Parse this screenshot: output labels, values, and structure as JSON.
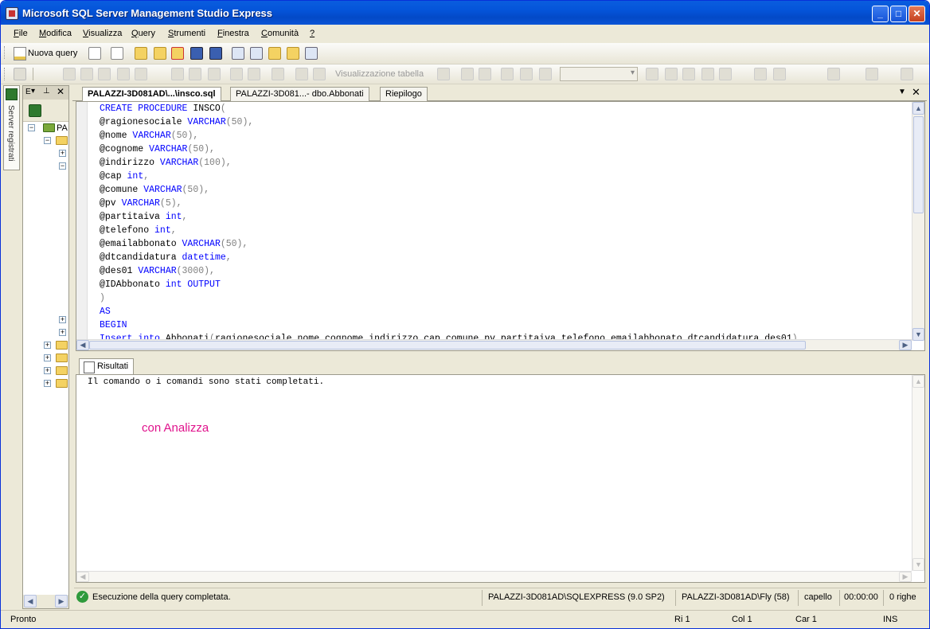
{
  "window": {
    "title": "Microsoft SQL Server Management Studio Express"
  },
  "menu": {
    "items": [
      "File",
      "Modifica",
      "Visualizza",
      "Query",
      "Strumenti",
      "Finestra",
      "Comunità",
      "?"
    ]
  },
  "toolbar": {
    "new_query": "Nuova query",
    "vis_tabella": "Visualizzazione tabella"
  },
  "sidebar": {
    "server_tab": "Server registrati",
    "oe_title": "E",
    "tree_root": "PA"
  },
  "doc_tabs": [
    {
      "label": "PALAZZI-3D081AD\\...\\insco.sql",
      "active": true
    },
    {
      "label": "PALAZZI-3D081...- dbo.Abbonati",
      "active": false
    },
    {
      "label": "Riepilogo",
      "active": false
    }
  ],
  "editor": {
    "lines": [
      [
        [
          "kw",
          "CREATE PROCEDURE"
        ],
        [
          "id",
          " INSCO"
        ],
        [
          "op",
          "("
        ]
      ],
      [
        [
          "id",
          "@ragionesociale "
        ],
        [
          "kw",
          "VARCHAR"
        ],
        [
          "op",
          "(50),"
        ]
      ],
      [
        [
          "id",
          "@nome "
        ],
        [
          "kw",
          "VARCHAR"
        ],
        [
          "op",
          "(50),"
        ]
      ],
      [
        [
          "id",
          "@cognome "
        ],
        [
          "kw",
          "VARCHAR"
        ],
        [
          "op",
          "(50),"
        ]
      ],
      [
        [
          "id",
          "@indirizzo "
        ],
        [
          "kw",
          "VARCHAR"
        ],
        [
          "op",
          "(100),"
        ]
      ],
      [
        [
          "id",
          "@cap "
        ],
        [
          "kw",
          "int"
        ],
        [
          "op",
          ","
        ]
      ],
      [
        [
          "id",
          "@comune "
        ],
        [
          "kw",
          "VARCHAR"
        ],
        [
          "op",
          "(50),"
        ]
      ],
      [
        [
          "id",
          "@pv "
        ],
        [
          "kw",
          "VARCHAR"
        ],
        [
          "op",
          "(5),"
        ]
      ],
      [
        [
          "id",
          "@partitaiva "
        ],
        [
          "kw",
          "int"
        ],
        [
          "op",
          ","
        ]
      ],
      [
        [
          "id",
          "@telefono "
        ],
        [
          "kw",
          "int"
        ],
        [
          "op",
          ","
        ]
      ],
      [
        [
          "id",
          "@emailabbonato "
        ],
        [
          "kw",
          "VARCHAR"
        ],
        [
          "op",
          "(50),"
        ]
      ],
      [
        [
          "id",
          "@dtcandidatura "
        ],
        [
          "kw",
          "datetime"
        ],
        [
          "op",
          ","
        ]
      ],
      [
        [
          "id",
          "@des01 "
        ],
        [
          "kw",
          "VARCHAR"
        ],
        [
          "op",
          "(3000),"
        ]
      ],
      [
        [
          "id",
          "@IDAbbonato "
        ],
        [
          "kw",
          "int OUTPUT"
        ]
      ],
      [
        [
          "op",
          ")"
        ]
      ],
      [
        [
          "kw",
          "AS"
        ]
      ],
      [
        [
          "kw",
          "BEGIN"
        ]
      ],
      [
        [
          "kw",
          "Insert into"
        ],
        [
          "id",
          " Abbonati"
        ],
        [
          "op",
          "("
        ],
        [
          "id",
          "ragionesociale"
        ],
        [
          "op",
          ","
        ],
        [
          "id",
          "nome"
        ],
        [
          "op",
          ","
        ],
        [
          "id",
          "cognome"
        ],
        [
          "op",
          ","
        ],
        [
          "id",
          "indirizzo"
        ],
        [
          "op",
          ","
        ],
        [
          "id",
          "cap"
        ],
        [
          "op",
          ","
        ],
        [
          "id",
          "comune"
        ],
        [
          "op",
          ","
        ],
        [
          "id",
          "pv"
        ],
        [
          "op",
          ","
        ],
        [
          "id",
          "partitaiva"
        ],
        [
          "op",
          ","
        ],
        [
          "id",
          "telefono"
        ],
        [
          "op",
          ","
        ],
        [
          "id",
          "emailabbonato"
        ],
        [
          "op",
          ","
        ],
        [
          "id",
          "dtcandidatura"
        ],
        [
          "op",
          ","
        ],
        [
          "id",
          "des01"
        ],
        [
          "op",
          ")"
        ]
      ]
    ]
  },
  "results": {
    "tab": "Risultati",
    "message": "Il comando o i comandi sono stati completati.",
    "annotation": "con Analizza"
  },
  "query_status": {
    "message": "Esecuzione della query completata.",
    "server": "PALAZZI-3D081AD\\SQLEXPRESS (9.0 SP2)",
    "user": "PALAZZI-3D081AD\\Fly (58)",
    "database": "capello",
    "elapsed": "00:00:00",
    "rows": "0 righe"
  },
  "status": {
    "ready": "Pronto",
    "line": "Ri 1",
    "col": "Col 1",
    "char": "Car 1",
    "mode": "INS"
  },
  "colors": {
    "keyword": "#0000ff",
    "annotation": "#e0128c",
    "titlebar": "#0454d9"
  }
}
